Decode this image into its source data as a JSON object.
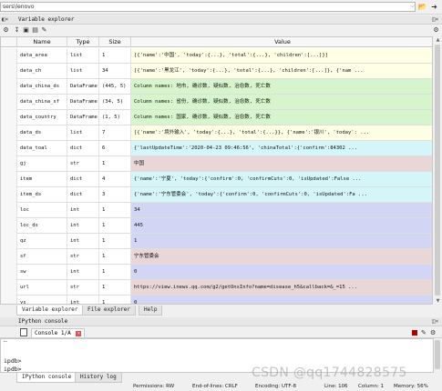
{
  "path_bar": {
    "path": "sers\\lenovo"
  },
  "variable_explorer": {
    "title": "Variable explorer",
    "columns": [
      "Name",
      "Type",
      "Size",
      "Value"
    ],
    "rows": [
      {
        "name": "data_area",
        "type": "list",
        "size": "1",
        "value": "[{'name':'中国', 'today':{...}, 'total':{...}, 'children':[...]}]",
        "color": "#ffffe6"
      },
      {
        "name": "data_ch",
        "type": "list",
        "size": "34",
        "value": "[{'name':'黑龙江', 'today':{...}, 'total':{...}, 'children':[...]}, {'nam ...",
        "color": "#ffffe6"
      },
      {
        "name": "data_china_ds",
        "type": "DataFrame",
        "size": "(445, 5)",
        "value": "Column names: 地市, 确诊数, 疑似数, 治愈数, 死亡数",
        "color": "#d6f5cc"
      },
      {
        "name": "data_china_sf",
        "type": "DataFrame",
        "size": "(34, 5)",
        "value": "Column names: 省份, 确诊数, 疑似数, 治愈数, 死亡数",
        "color": "#d6f5cc"
      },
      {
        "name": "data_country",
        "type": "DataFrame",
        "size": "(1, 5)",
        "value": "Column names: 国家, 确诊数, 疑似数, 治愈数, 死亡数",
        "color": "#d6f5cc"
      },
      {
        "name": "data_ds",
        "type": "list",
        "size": "7",
        "value": "[{'name':'境外输入', 'today':{...}, 'total':{...}}, {'name':'银川', 'today': ...",
        "color": "#ffffe6"
      },
      {
        "name": "data_toal",
        "type": "dict",
        "size": "6",
        "value": "{'lastUpdateTime':'2020-04-23 09:46:56', 'chinaTotal':{'confirm':84302 ...",
        "color": "#d4f6f8"
      },
      {
        "name": "gj",
        "type": "str",
        "size": "1",
        "value": "中国",
        "color": "#e9d7d7"
      },
      {
        "name": "item",
        "type": "dict",
        "size": "4",
        "value": "{'name':'宁夏', 'today':{'confirm':0, 'confirmCuts':0, 'isUpdated':False ...",
        "color": "#d4f6f8"
      },
      {
        "name": "item_ds",
        "type": "dict",
        "size": "3",
        "value": "{'name':'宁东管委会', 'today':{'confirm':0, 'confirmCuts':0, 'isUpdated':Fa ...",
        "color": "#d4f6f8"
      },
      {
        "name": "loc",
        "type": "int",
        "size": "1",
        "value": "34",
        "color": "#d3d5f5"
      },
      {
        "name": "loc_ds",
        "type": "int",
        "size": "1",
        "value": "445",
        "color": "#d3d5f5"
      },
      {
        "name": "qz",
        "type": "int",
        "size": "1",
        "value": "1",
        "color": "#d3d5f5"
      },
      {
        "name": "sf",
        "type": "str",
        "size": "1",
        "value": "宁东管委会",
        "color": "#e9d7d7"
      },
      {
        "name": "sw",
        "type": "int",
        "size": "1",
        "value": "0",
        "color": "#d3d5f5"
      },
      {
        "name": "url",
        "type": "str",
        "size": "1",
        "value": "https://view.inews.qq.com/g2/getOnsInfo?name=disease_h5&callback=&_=15 ...",
        "color": "#e9d7d7"
      },
      {
        "name": "ys",
        "type": "int",
        "size": "1",
        "value": "0",
        "color": "#d3d5f5"
      }
    ],
    "tabs": [
      "Variable explorer",
      "File explorer",
      "Help"
    ]
  },
  "ipython": {
    "title": "IPython console",
    "console_tab": "Console 1/A",
    "lines": [
      "ipdb>",
      "ipdb>"
    ],
    "tabs": [
      "IPython console",
      "History log"
    ]
  },
  "status": {
    "permissions": "Permissions: RW",
    "eol": "End-of-lines: CRLF",
    "encoding": "Encoding: UTF-8",
    "line": "Line: 106",
    "column": "Column: 1",
    "memory": "Memory: 56%"
  },
  "watermark": "CSDN @qq1744828575"
}
